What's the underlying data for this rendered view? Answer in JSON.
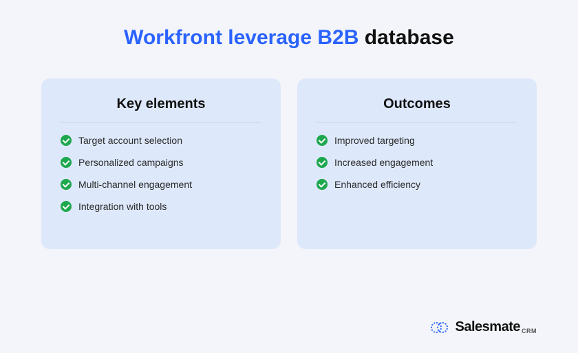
{
  "title": {
    "highlight": "Workfront leverage B2B",
    "rest": "database"
  },
  "cards": [
    {
      "title": "Key elements",
      "items": [
        "Target account selection",
        "Personalized campaigns",
        "Multi-channel engagement",
        "Integration with tools"
      ]
    },
    {
      "title": "Outcomes",
      "items": [
        "Improved targeting",
        "Increased engagement",
        "Enhanced efficiency"
      ]
    }
  ],
  "brand": {
    "name": "Salesmate",
    "suffix": "CRM"
  }
}
